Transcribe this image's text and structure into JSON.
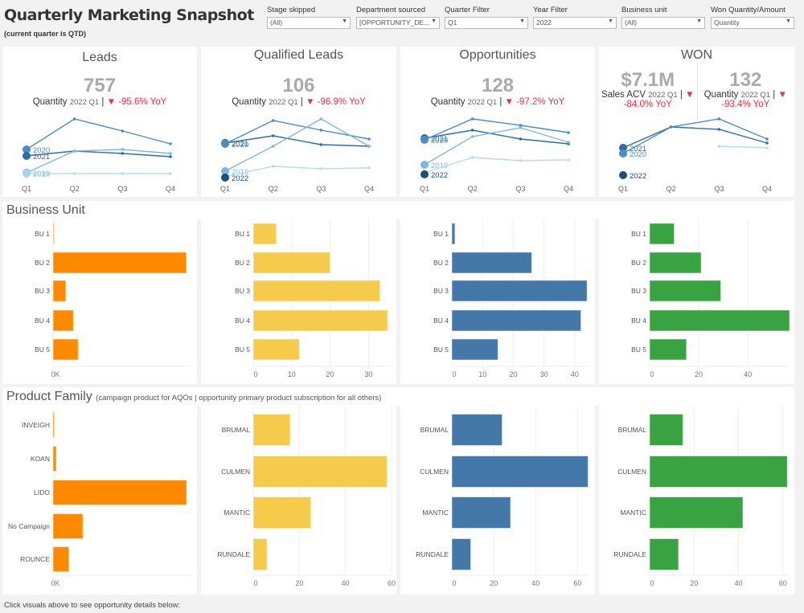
{
  "header": {
    "title": "Quarterly Marketing Snapshot",
    "subtitle": "(current quarter is QTD)"
  },
  "filters": [
    {
      "label": "Stage skipped",
      "value": "(All)"
    },
    {
      "label": "Department sourced",
      "value": "[OPPORTUNITY_DE..."
    },
    {
      "label": "Quarter Filter",
      "value": "Q1"
    },
    {
      "label": "Year Filter",
      "value": "2022"
    },
    {
      "label": "Business unit",
      "value": "(All)"
    },
    {
      "label": "Won Quantity/Amount",
      "value": "Quantity"
    }
  ],
  "icons": {
    "dropdown": "caret-down-icon",
    "yoy_down": "triangle-down-icon"
  },
  "colors": {
    "leads": "#ff8a00",
    "qualified_leads": "#f6cb4c",
    "opportunities": "#4378a8",
    "won": "#3aa341",
    "decline": "#e8323c",
    "year_2022": "#1f4e79",
    "year_2021": "#2e6da4",
    "year_2020": "#4a8cc4",
    "year_2019": "#7fb8e0",
    "year_other": "#b6dbf2"
  },
  "kpis": [
    {
      "title": "Leads",
      "metrics": [
        {
          "value": "757",
          "measure": "Quantity",
          "period": "2022 Q1",
          "sep": "|",
          "arrow": "▼",
          "change": "-95.6% YoY"
        }
      ]
    },
    {
      "title": "Qualified Leads",
      "metrics": [
        {
          "value": "106",
          "measure": "Quantity",
          "period": "2022 Q1",
          "sep": "|",
          "arrow": "▼",
          "change": "-96.9% YoY"
        }
      ]
    },
    {
      "title": "Opportunities",
      "metrics": [
        {
          "value": "128",
          "measure": "Quantity",
          "period": "2022 Q1",
          "sep": "|",
          "arrow": "▼",
          "change": "-97.2% YoY"
        }
      ]
    },
    {
      "title": "WON",
      "metrics": [
        {
          "value": "$7.1M",
          "measure": "Sales ACV",
          "period": "2022 Q1",
          "sep": "|",
          "arrow": "▼",
          "change": "-84.0% YoY"
        },
        {
          "value": "132",
          "measure": "Quantity",
          "period": "2022 Q1",
          "sep": "|",
          "arrow": "▼",
          "change": "-93.4% YoY"
        }
      ]
    }
  ],
  "sections": {
    "business_unit": "Business Unit",
    "product_family": "Product Family",
    "product_family_note": "(campaign product for AQOs | opportunity primary product subscription for all others)"
  },
  "footer": "Click visuals above to see opportunity details below:",
  "chart_data": [
    {
      "type": "line",
      "chart": "Leads trend",
      "categories": [
        "Q1",
        "Q2",
        "Q3",
        "Q4"
      ],
      "series": [
        {
          "name": "2020",
          "color": "#4a8cc4",
          "values": [
            54,
            92,
            77,
            61
          ]
        },
        {
          "name": "2021",
          "color": "#2e6da4",
          "values": [
            46,
            52,
            49,
            45
          ]
        },
        {
          "color": "#b6dbf2",
          "values": [
            24,
            24,
            24,
            24
          ]
        },
        {
          "name": "2019",
          "color": "#7fb8e0",
          "values": [
            25,
            52,
            54,
            49
          ]
        },
        {
          "name": "2022",
          "color": "#a9d3ef",
          "values": [
            24,
            null,
            null,
            null
          ]
        }
      ]
    },
    {
      "type": "line",
      "chart": "Qualified Leads trend",
      "categories": [
        "Q1",
        "Q2",
        "Q3",
        "Q4"
      ],
      "series": [
        {
          "name": "2021",
          "color": "#2e6da4",
          "values": [
            62,
            71,
            60,
            58
          ]
        },
        {
          "name": "2020",
          "color": "#4a8cc4",
          "values": [
            61,
            90,
            78,
            67
          ]
        },
        {
          "name": "2019",
          "color": "#7fb8e0",
          "values": [
            27,
            58,
            92,
            58
          ]
        },
        {
          "color": "#b6dbf2",
          "values": [
            20,
            33,
            30,
            31
          ]
        },
        {
          "name": "2022",
          "color": "#1f4e79",
          "values": [
            19,
            null,
            null,
            null
          ]
        }
      ]
    },
    {
      "type": "line",
      "chart": "Opportunities trend",
      "categories": [
        "Q1",
        "Q2",
        "Q3",
        "Q4"
      ],
      "series": [
        {
          "name": "2021",
          "color": "#2e6da4",
          "values": [
            68,
            78,
            67,
            61
          ]
        },
        {
          "name": "2020",
          "color": "#4a8cc4",
          "values": [
            66,
            92,
            84,
            75
          ]
        },
        {
          "name": "2019",
          "color": "#7fb8e0",
          "values": [
            35,
            70,
            81,
            63
          ]
        },
        {
          "color": "#b6dbf2",
          "values": [
            25,
            44,
            40,
            41
          ]
        },
        {
          "name": "2022",
          "color": "#1f4e79",
          "values": [
            23,
            null,
            null,
            null
          ]
        }
      ]
    },
    {
      "type": "line",
      "chart": "WON trend",
      "categories": [
        "Q1",
        "Q2",
        "Q3",
        "Q4"
      ],
      "series": [
        {
          "name": "2021",
          "color": "#2e6da4",
          "values": [
            56,
            82,
            79,
            62
          ]
        },
        {
          "name": "2020",
          "color": "#4a8cc4",
          "values": [
            49,
            82,
            92,
            67
          ]
        },
        {
          "color": "#b6dbf2",
          "values": [
            null,
            null,
            58,
            56
          ]
        },
        {
          "name": "2022",
          "color": "#1f4e79",
          "values": [
            22,
            null,
            null,
            null
          ]
        }
      ]
    },
    {
      "type": "bar",
      "group": "business_unit",
      "chart": "Leads",
      "color": "#ff8a00",
      "categories": [
        "BU 1",
        "BU 2",
        "BU 3",
        "BU 4",
        "BU 5"
      ],
      "values": [
        2,
        527,
        50,
        80,
        99
      ],
      "xlim": [
        0,
        550
      ],
      "ticks": [
        {
          "v": 0,
          "label": "0K"
        }
      ]
    },
    {
      "type": "bar",
      "group": "business_unit",
      "chart": "Qualified Leads",
      "color": "#f6cb4c",
      "categories": [
        "BU 1",
        "BU 2",
        "BU 3",
        "BU 4",
        "BU 5"
      ],
      "values": [
        6,
        20,
        33,
        35,
        12
      ],
      "xlim": [
        0,
        36
      ],
      "ticks": [
        {
          "v": 0,
          "label": "0"
        },
        {
          "v": 10,
          "label": "10"
        },
        {
          "v": 20,
          "label": "20"
        },
        {
          "v": 30,
          "label": "30"
        }
      ]
    },
    {
      "type": "bar",
      "group": "business_unit",
      "chart": "Opportunities",
      "color": "#4378a8",
      "categories": [
        "BU 1",
        "BU 2",
        "BU 3",
        "BU 4",
        "BU 5"
      ],
      "values": [
        1,
        26,
        44,
        42,
        15
      ],
      "xlim": [
        0,
        45
      ],
      "ticks": [
        {
          "v": 0,
          "label": "0"
        },
        {
          "v": 10,
          "label": "10"
        },
        {
          "v": 20,
          "label": "20"
        },
        {
          "v": 30,
          "label": "30"
        },
        {
          "v": 40,
          "label": "40"
        }
      ]
    },
    {
      "type": "bar",
      "group": "business_unit",
      "chart": "WON",
      "color": "#3aa341",
      "categories": [
        "BU 1",
        "BU 2",
        "BU 3",
        "BU 4",
        "BU 5"
      ],
      "values": [
        10,
        21,
        29,
        57,
        15
      ],
      "xlim": [
        0,
        57
      ],
      "ticks": [
        {
          "v": 0,
          "label": "0"
        },
        {
          "v": 20,
          "label": "20"
        },
        {
          "v": 40,
          "label": "40"
        }
      ]
    },
    {
      "type": "bar",
      "group": "product_family",
      "chart": "Leads",
      "color": "#ff8a00",
      "categories": [
        "INVEIGH",
        "KOAN",
        "LIDO",
        "No Campaign",
        "ROUNCE"
      ],
      "values": [
        5,
        13,
        552,
        123,
        65
      ],
      "xlim": [
        0,
        575
      ],
      "ticks": [
        {
          "v": 0,
          "label": "0K"
        }
      ]
    },
    {
      "type": "bar",
      "group": "product_family",
      "chart": "Qualified Leads",
      "color": "#f6cb4c",
      "categories": [
        "BRUMAL",
        "CULMEN",
        "MANTIC",
        "RUNDALE"
      ],
      "values": [
        16,
        58,
        25,
        6
      ],
      "xlim": [
        0,
        60
      ],
      "ticks": [
        {
          "v": 0,
          "label": "0"
        },
        {
          "v": 20,
          "label": "20"
        },
        {
          "v": 40,
          "label": "40"
        },
        {
          "v": 60,
          "label": "60"
        }
      ]
    },
    {
      "type": "bar",
      "group": "product_family",
      "chart": "Opportunities",
      "color": "#4378a8",
      "categories": [
        "BRUMAL",
        "CULMEN",
        "MANTIC",
        "RUNDALE"
      ],
      "values": [
        24,
        65,
        28,
        9
      ],
      "xlim": [
        0,
        66
      ],
      "ticks": [
        {
          "v": 0,
          "label": "0"
        },
        {
          "v": 20,
          "label": "20"
        },
        {
          "v": 40,
          "label": "40"
        },
        {
          "v": 60,
          "label": "60"
        }
      ]
    },
    {
      "type": "bar",
      "group": "product_family",
      "chart": "WON",
      "color": "#3aa341",
      "categories": [
        "BRUMAL",
        "CULMEN",
        "MANTIC",
        "RUNDALE"
      ],
      "values": [
        15,
        62,
        42,
        13
      ],
      "xlim": [
        0,
        63
      ],
      "ticks": [
        {
          "v": 0,
          "label": "0"
        },
        {
          "v": 20,
          "label": "20"
        },
        {
          "v": 40,
          "label": "40"
        },
        {
          "v": 60,
          "label": "60"
        }
      ]
    }
  ]
}
